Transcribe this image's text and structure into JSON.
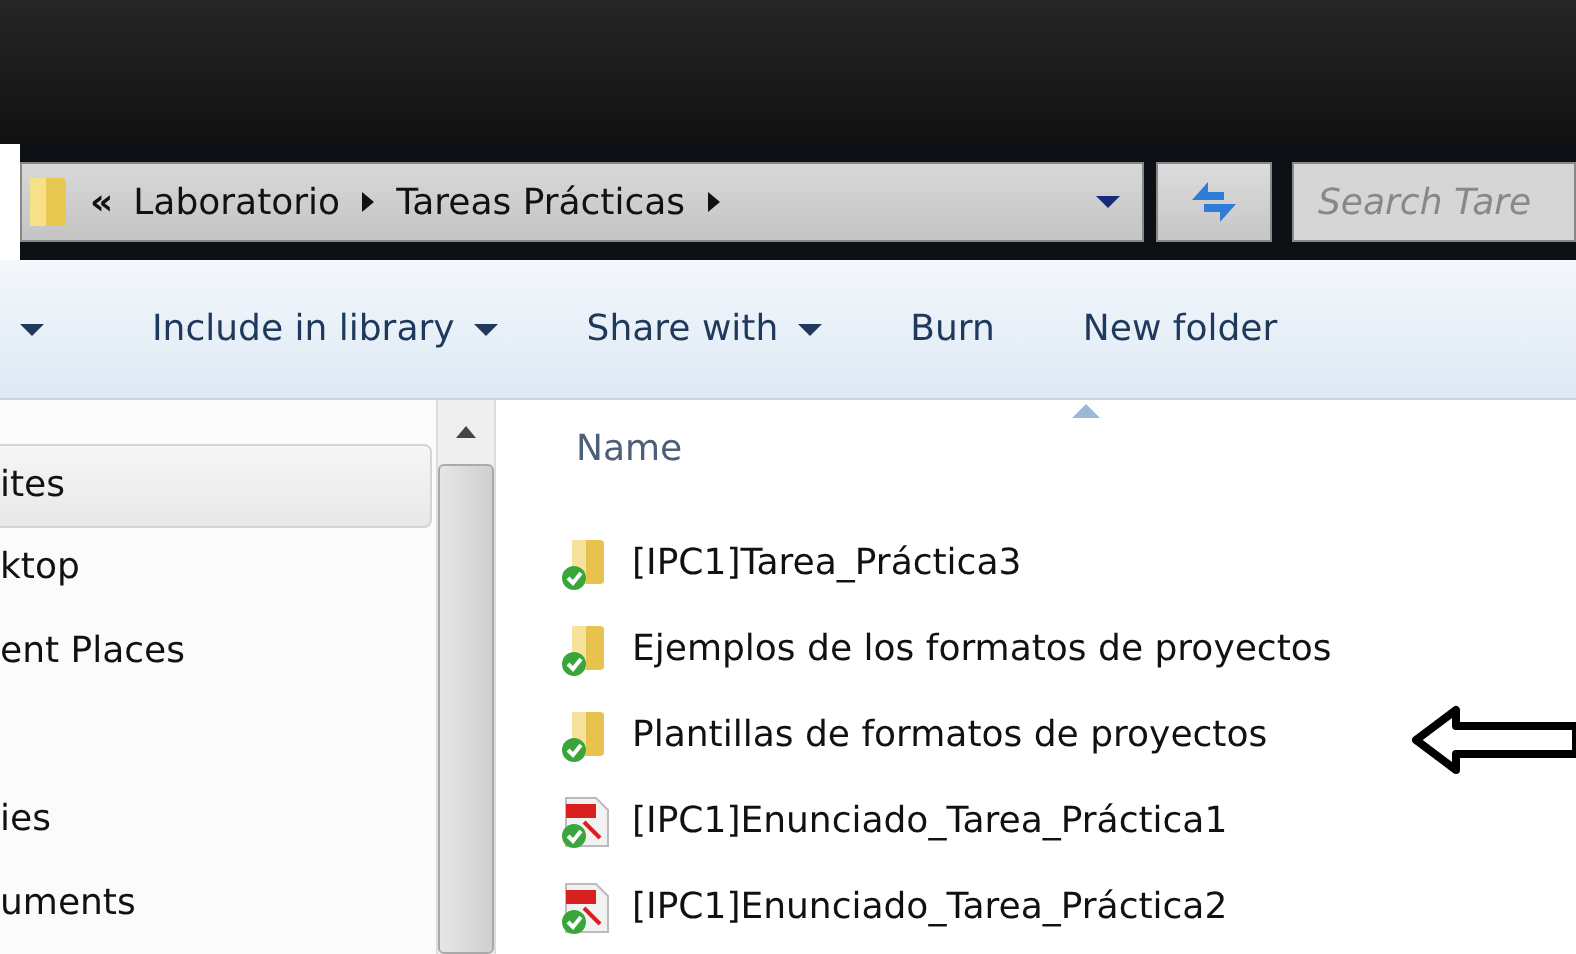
{
  "address_bar": {
    "overflow": "«",
    "crumbs": [
      "Laboratorio",
      "Tareas Prácticas"
    ]
  },
  "search": {
    "placeholder": "Search Tare"
  },
  "toolbar": {
    "items": [
      {
        "label": "Include in library",
        "menu": true
      },
      {
        "label": "Share with",
        "menu": true
      },
      {
        "label": "Burn",
        "menu": false
      },
      {
        "label": "New folder",
        "menu": false
      }
    ]
  },
  "sidebar": {
    "groups": [
      {
        "items": [
          {
            "label": "ites",
            "selected": true
          },
          {
            "label": "ktop",
            "selected": false
          },
          {
            "label": "ent Places",
            "selected": false
          }
        ]
      },
      {
        "items": [
          {
            "label": "ies",
            "selected": false
          },
          {
            "label": "uments",
            "selected": false
          }
        ]
      }
    ]
  },
  "file_list": {
    "column": "Name",
    "items": [
      {
        "name": "[IPC1]Tarea_Práctica3",
        "kind": "folder"
      },
      {
        "name": "Ejemplos de los formatos de proyectos",
        "kind": "folder"
      },
      {
        "name": "Plantillas de formatos de proyectos",
        "kind": "folder"
      },
      {
        "name": "[IPC1]Enunciado_Tarea_Práctica1",
        "kind": "pdf"
      },
      {
        "name": "[IPC1]Enunciado_Tarea_Práctica2",
        "kind": "pdf"
      }
    ]
  }
}
